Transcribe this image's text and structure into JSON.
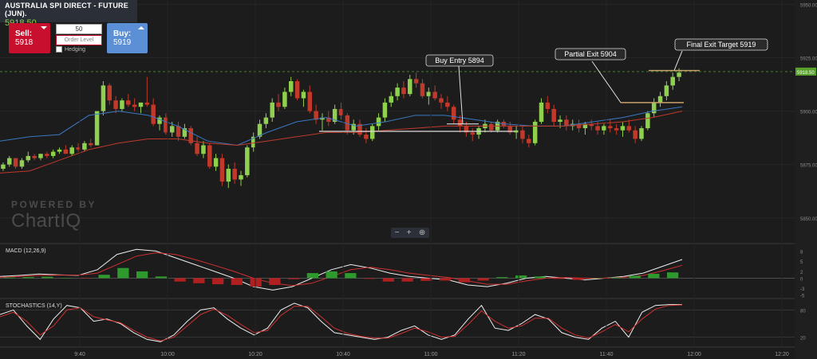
{
  "header": {
    "symbol": "AUSTRALIA SPI DIRECT - FUTURE (JUN).",
    "last_price": "5918.50"
  },
  "trade": {
    "sell_label": "Sell:",
    "sell_price": "5918",
    "buy_label": "Buy:",
    "buy_price": "5919",
    "quantity": "50",
    "order_level_placeholder": "Order Level",
    "hedging_label": "Hedging"
  },
  "watermark": {
    "line1": "POWERED BY",
    "line2": "ChartIQ"
  },
  "zoom": {
    "minus": "−",
    "plus": "+",
    "search": "⊕"
  },
  "colors": {
    "background": "#1c1c1c",
    "bull": "#8fd14f",
    "bear": "#c0392b",
    "sell": "#c8102e",
    "buy": "#5b8fd6",
    "ma_fast": "#3a78c2",
    "ma_slow": "#c0392b",
    "annotation_line": "#c8a06a"
  },
  "chart_data": [
    {
      "type": "candlestick",
      "title": "AUSTRALIA SPI DIRECT - FUTURE (JUN).",
      "x_ticks": [
        "9:40",
        "10:00",
        "10:20",
        "10:40",
        "11:00",
        "11:20",
        "11:40",
        "12:00",
        "12:20"
      ],
      "y_ticks": [
        5850,
        5875,
        5900,
        5925,
        5950
      ],
      "ylim": [
        5838,
        5952
      ],
      "current_price": 5918.5,
      "current_price_label": "5918.50",
      "series": [
        {
          "name": "",
          "kind": "moving_average_fast",
          "values": [
            5886,
            5888,
            5889,
            5898,
            5900,
            5898,
            5893,
            5886,
            5884,
            5890,
            5895,
            5897,
            5893,
            5895,
            5898,
            5898,
            5896,
            5894,
            5893,
            5893,
            5895,
            5897,
            5900,
            5902
          ]
        },
        {
          "name": "",
          "kind": "moving_average_slow",
          "values": [
            5871,
            5872,
            5877,
            5882,
            5885,
            5887,
            5887,
            5885,
            5884,
            5886,
            5888,
            5890,
            5890,
            5891,
            5892,
            5893,
            5893,
            5893,
            5893,
            5893,
            5894,
            5895,
            5897,
            5900
          ]
        }
      ],
      "candles": [
        [
          5873,
          5876,
          5872,
          5875
        ],
        [
          5875,
          5879,
          5874,
          5878
        ],
        [
          5878,
          5877,
          5873,
          5874
        ],
        [
          5874,
          5878,
          5873,
          5877
        ],
        [
          5877,
          5881,
          5876,
          5879
        ],
        [
          5879,
          5880,
          5877,
          5878
        ],
        [
          5878,
          5880,
          5877,
          5880
        ],
        [
          5880,
          5881,
          5878,
          5879
        ],
        [
          5879,
          5882,
          5878,
          5881
        ],
        [
          5881,
          5883,
          5880,
          5882
        ],
        [
          5882,
          5884,
          5880,
          5880
        ],
        [
          5880,
          5884,
          5879,
          5883
        ],
        [
          5883,
          5885,
          5881,
          5882
        ],
        [
          5882,
          5886,
          5881,
          5885
        ],
        [
          5885,
          5887,
          5883,
          5884
        ],
        [
          5884,
          5890,
          5884,
          5900
        ],
        [
          5900,
          5914,
          5898,
          5912
        ],
        [
          5912,
          5913,
          5903,
          5905
        ],
        [
          5905,
          5907,
          5899,
          5901
        ],
        [
          5901,
          5906,
          5900,
          5905
        ],
        [
          5905,
          5908,
          5902,
          5903
        ],
        [
          5903,
          5906,
          5900,
          5902
        ],
        [
          5902,
          5904,
          5899,
          5904
        ],
        [
          5904,
          5916,
          5902,
          5903
        ],
        [
          5903,
          5906,
          5893,
          5894
        ],
        [
          5894,
          5898,
          5891,
          5897
        ],
        [
          5897,
          5899,
          5889,
          5890
        ],
        [
          5890,
          5895,
          5888,
          5893
        ],
        [
          5893,
          5895,
          5886,
          5888
        ],
        [
          5888,
          5894,
          5887,
          5892
        ],
        [
          5892,
          5893,
          5884,
          5885
        ],
        [
          5885,
          5888,
          5879,
          5880
        ],
        [
          5880,
          5886,
          5878,
          5884
        ],
        [
          5884,
          5885,
          5873,
          5874
        ],
        [
          5874,
          5880,
          5872,
          5878
        ],
        [
          5878,
          5880,
          5865,
          5867
        ],
        [
          5867,
          5875,
          5864,
          5873
        ],
        [
          5873,
          5876,
          5866,
          5868
        ],
        [
          5868,
          5872,
          5865,
          5870
        ],
        [
          5870,
          5884,
          5869,
          5883
        ],
        [
          5883,
          5890,
          5881,
          5888
        ],
        [
          5888,
          5896,
          5887,
          5894
        ],
        [
          5894,
          5899,
          5892,
          5897
        ],
        [
          5897,
          5906,
          5895,
          5904
        ],
        [
          5904,
          5908,
          5900,
          5902
        ],
        [
          5902,
          5911,
          5901,
          5909
        ],
        [
          5909,
          5916,
          5907,
          5914
        ],
        [
          5914,
          5915,
          5905,
          5906
        ],
        [
          5906,
          5910,
          5902,
          5909
        ],
        [
          5909,
          5912,
          5899,
          5900
        ],
        [
          5900,
          5903,
          5894,
          5896
        ],
        [
          5896,
          5899,
          5891,
          5897
        ],
        [
          5897,
          5900,
          5893,
          5895
        ],
        [
          5895,
          5903,
          5894,
          5901
        ],
        [
          5901,
          5904,
          5896,
          5898
        ],
        [
          5898,
          5899,
          5889,
          5891
        ],
        [
          5891,
          5896,
          5889,
          5894
        ],
        [
          5894,
          5896,
          5888,
          5889
        ],
        [
          5889,
          5892,
          5885,
          5887
        ],
        [
          5887,
          5894,
          5886,
          5893
        ],
        [
          5893,
          5899,
          5891,
          5897
        ],
        [
          5897,
          5906,
          5895,
          5904
        ],
        [
          5904,
          5909,
          5902,
          5907
        ],
        [
          5907,
          5913,
          5905,
          5911
        ],
        [
          5911,
          5914,
          5906,
          5908
        ],
        [
          5908,
          5917,
          5907,
          5915
        ],
        [
          5915,
          5918,
          5911,
          5913
        ],
        [
          5913,
          5915,
          5906,
          5907
        ],
        [
          5907,
          5911,
          5903,
          5909
        ],
        [
          5909,
          5912,
          5905,
          5906
        ],
        [
          5906,
          5908,
          5901,
          5904
        ],
        [
          5904,
          5907,
          5900,
          5902
        ],
        [
          5902,
          5903,
          5894,
          5896
        ],
        [
          5896,
          5898,
          5890,
          5893
        ],
        [
          5893,
          5895,
          5888,
          5890
        ],
        [
          5890,
          5892,
          5886,
          5889
        ],
        [
          5889,
          5893,
          5887,
          5892
        ],
        [
          5892,
          5896,
          5890,
          5894
        ],
        [
          5894,
          5895,
          5890,
          5891
        ],
        [
          5891,
          5896,
          5890,
          5895
        ],
        [
          5895,
          5896,
          5892,
          5893
        ],
        [
          5893,
          5895,
          5889,
          5890
        ],
        [
          5890,
          5893,
          5887,
          5891
        ],
        [
          5891,
          5893,
          5885,
          5887
        ],
        [
          5887,
          5889,
          5883,
          5885
        ],
        [
          5885,
          5896,
          5884,
          5895
        ],
        [
          5895,
          5906,
          5894,
          5904
        ],
        [
          5904,
          5907,
          5899,
          5901
        ],
        [
          5901,
          5903,
          5893,
          5895
        ],
        [
          5895,
          5898,
          5892,
          5896
        ],
        [
          5896,
          5898,
          5891,
          5893
        ],
        [
          5893,
          5896,
          5891,
          5894
        ],
        [
          5894,
          5896,
          5890,
          5892
        ],
        [
          5892,
          5895,
          5889,
          5894
        ],
        [
          5894,
          5896,
          5891,
          5893
        ],
        [
          5893,
          5895,
          5889,
          5891
        ],
        [
          5891,
          5894,
          5889,
          5893
        ],
        [
          5893,
          5896,
          5890,
          5892
        ],
        [
          5892,
          5894,
          5889,
          5891
        ],
        [
          5891,
          5895,
          5888,
          5893
        ],
        [
          5893,
          5896,
          5890,
          5891
        ],
        [
          5891,
          5893,
          5885,
          5887
        ],
        [
          5887,
          5893,
          5886,
          5892
        ],
        [
          5892,
          5900,
          5891,
          5899
        ],
        [
          5899,
          5906,
          5897,
          5904
        ],
        [
          5904,
          5909,
          5902,
          5907
        ],
        [
          5907,
          5914,
          5905,
          5912
        ],
        [
          5912,
          5918,
          5910,
          5916
        ],
        [
          5916,
          5920,
          5914,
          5918
        ]
      ],
      "annotations": [
        {
          "label": "Buy Entry 5894",
          "price": 5894
        },
        {
          "label": "Partial Exit 5904",
          "price": 5904
        },
        {
          "label": "Final Exit Target 5919",
          "price": 5919
        }
      ]
    },
    {
      "type": "line",
      "title": "MACD (12,26,9)",
      "y_ticks": [
        -5,
        -3,
        0,
        2,
        5,
        8
      ],
      "ylim": [
        -6,
        9.5
      ],
      "series": [
        {
          "name": "",
          "kind": "macd",
          "values": [
            0.5,
            0.8,
            1.2,
            1.0,
            0.8,
            2.5,
            7.0,
            8.5,
            8.0,
            6.0,
            4.0,
            2.0,
            0,
            -2.5,
            -3.5,
            -2.5,
            0,
            2.5,
            4.0,
            3.0,
            1.5,
            0.5,
            0,
            -0.5,
            -2.0,
            -2.5,
            -1.5,
            0,
            0.5,
            0,
            -0.5,
            0,
            0.5,
            1.5,
            3.5,
            5.5
          ]
        },
        {
          "name": "",
          "kind": "signal",
          "values": [
            0.3,
            0.5,
            0.8,
            0.9,
            0.9,
            1.5,
            4.0,
            6.5,
            7.5,
            7.0,
            5.5,
            3.8,
            2.0,
            0,
            -1.5,
            -2.2,
            -1.5,
            0.5,
            2.5,
            3.2,
            2.5,
            1.5,
            0.8,
            0.2,
            -0.8,
            -1.8,
            -1.8,
            -0.8,
            0,
            0.2,
            0,
            0,
            0.3,
            0.8,
            2.2,
            3.8
          ]
        },
        {
          "name": "",
          "kind": "histogram",
          "values": [
            0.2,
            0.3,
            0.4,
            0.1,
            -0.1,
            1.0,
            3.0,
            2.0,
            0.5,
            -1.0,
            -1.5,
            -1.8,
            -2.0,
            -2.5,
            -2.0,
            -0.3,
            1.5,
            2.0,
            1.5,
            -0.2,
            -1.0,
            -1.0,
            -0.8,
            -0.7,
            -1.2,
            -0.7,
            0.3,
            0.8,
            0.5,
            -0.2,
            -0.5,
            0,
            0.2,
            0.7,
            1.3,
            1.7
          ]
        }
      ]
    },
    {
      "type": "line",
      "title": "STOCHASTICS (14,Y)",
      "y_ticks": [
        20,
        80
      ],
      "ylim": [
        0,
        100
      ],
      "series": [
        {
          "name": "",
          "kind": "%K",
          "values": [
            70,
            80,
            45,
            15,
            60,
            90,
            85,
            55,
            60,
            50,
            30,
            15,
            10,
            25,
            55,
            80,
            85,
            60,
            40,
            25,
            40,
            80,
            95,
            85,
            55,
            30,
            25,
            20,
            15,
            20,
            35,
            45,
            25,
            15,
            25,
            60,
            90,
            40,
            35,
            50,
            70,
            60,
            30,
            20,
            15,
            40,
            55,
            20,
            75,
            90,
            92,
            92
          ]
        },
        {
          "name": "",
          "kind": "%D",
          "values": [
            65,
            75,
            55,
            25,
            45,
            80,
            85,
            65,
            58,
            52,
            35,
            20,
            12,
            20,
            45,
            70,
            82,
            68,
            48,
            30,
            35,
            68,
            88,
            88,
            65,
            40,
            28,
            22,
            18,
            18,
            28,
            40,
            32,
            20,
            22,
            48,
            78,
            55,
            40,
            45,
            62,
            62,
            40,
            25,
            18,
            32,
            48,
            32,
            60,
            82,
            90,
            91
          ]
        }
      ]
    }
  ]
}
